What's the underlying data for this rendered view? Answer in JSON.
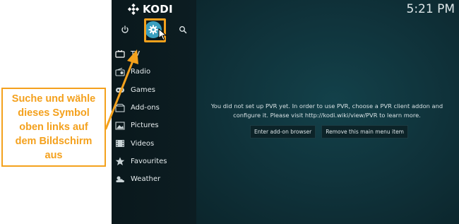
{
  "app": {
    "name": "KODI"
  },
  "clock": {
    "time": "5:21 PM"
  },
  "top_icons": {
    "power": "power-icon",
    "settings": "gear-icon",
    "search": "search-icon"
  },
  "menu": {
    "items": [
      {
        "label": "TV",
        "icon": "tv-icon"
      },
      {
        "label": "Radio",
        "icon": "radio-icon"
      },
      {
        "label": "Games",
        "icon": "gamepad-icon"
      },
      {
        "label": "Add-ons",
        "icon": "addons-icon"
      },
      {
        "label": "Pictures",
        "icon": "pictures-icon"
      },
      {
        "label": "Videos",
        "icon": "videos-icon"
      },
      {
        "label": "Favourites",
        "icon": "star-icon"
      },
      {
        "label": "Weather",
        "icon": "weather-icon"
      }
    ]
  },
  "main": {
    "message": "You did not set up PVR yet. In order to use PVR, choose a PVR client addon and configure it. Please visit http://kodi.wiki/view/PVR to learn more.",
    "buttons": {
      "enter_addon_browser": "Enter add-on browser",
      "remove_item": "Remove this main menu item"
    }
  },
  "annotation": {
    "text": "Suche und wähle\ndieses Symbol\noben links auf\ndem Bildschirm\naus",
    "color": "#f4a11d"
  },
  "colors": {
    "accent": "#3a9fbf",
    "highlight": "#f4a11d",
    "background": "#0f2f36",
    "sidebar": "#0b1a1e"
  }
}
